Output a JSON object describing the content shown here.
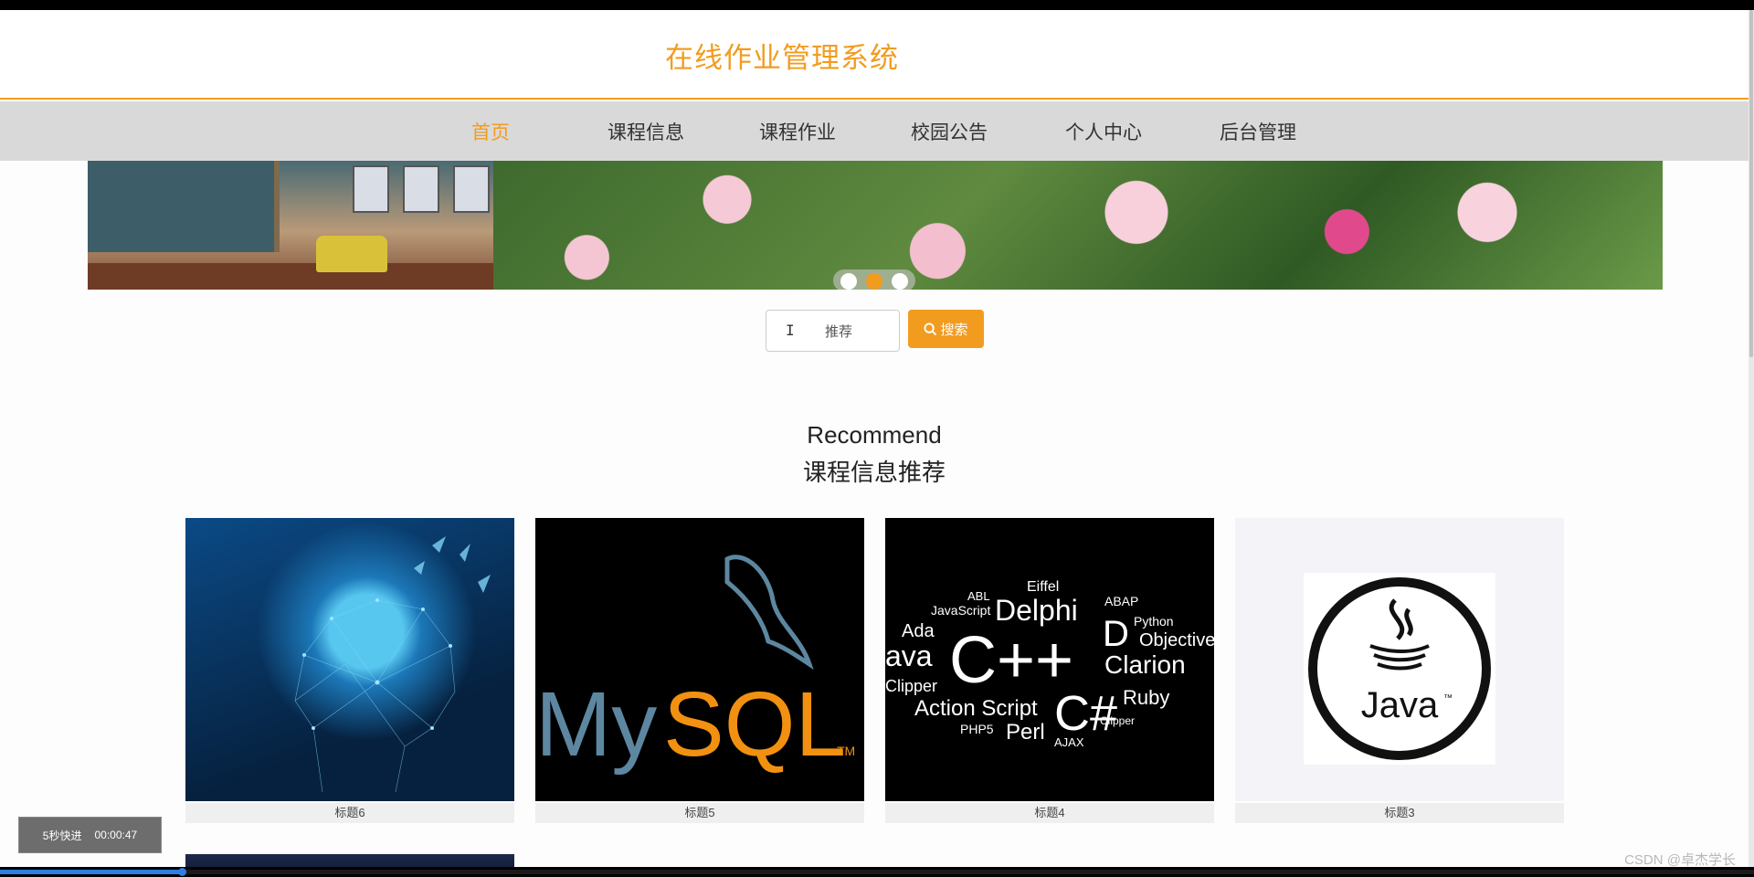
{
  "header": {
    "title": "在线作业管理系统"
  },
  "nav": {
    "items": [
      {
        "label": "首页",
        "active": true
      },
      {
        "label": "课程信息",
        "active": false
      },
      {
        "label": "课程作业",
        "active": false
      },
      {
        "label": "校园公告",
        "active": false
      },
      {
        "label": "个人中心",
        "active": false
      },
      {
        "label": "后台管理",
        "active": false
      }
    ]
  },
  "banner": {
    "slide_count": 3,
    "active_slide": 2
  },
  "search": {
    "value": "推荐",
    "button_label": "搜索",
    "icon": "search-icon"
  },
  "section": {
    "title_en": "Recommend",
    "title_cn": "课程信息推荐"
  },
  "cards": [
    {
      "caption": "标题6",
      "image": "brain-network-image"
    },
    {
      "caption": "标题5",
      "image": "mysql-logo-image"
    },
    {
      "caption": "标题4",
      "image": "programming-languages-wordcloud-image"
    },
    {
      "caption": "标题3",
      "image": "java-logo-image"
    }
  ],
  "mysql_logo": {
    "text_my": "My",
    "text_sql": "SQL",
    "tm": "TM"
  },
  "langs_cloud": [
    "Eiffel",
    "ABL",
    "JavaScript",
    "Delphi",
    "ABAP",
    "Python",
    "Ada",
    "D",
    "Objective",
    "ava",
    "C++",
    "Clarion",
    "Clipper",
    "Action Script",
    "C#",
    "Ruby",
    "PHP5",
    "Perl",
    "Clipper",
    "AJAX"
  ],
  "java_logo": {
    "text": "Java",
    "tm": "™"
  },
  "player": {
    "speed_label": "5秒快进",
    "time": "00:00:47",
    "progress_percent": 10.4
  },
  "watermark": "CSDN @卓杰学长",
  "colors": {
    "accent": "#f29c1f",
    "nav_bg": "#d9d9d9",
    "caption_bg": "#efefef"
  }
}
